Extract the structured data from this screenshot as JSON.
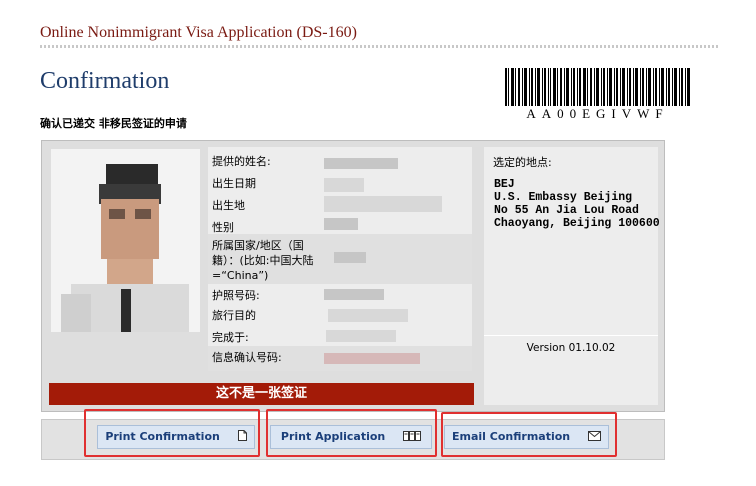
{
  "header": {
    "app_title": "Online Nonimmigrant Visa Application (DS-160)",
    "page_title": "Confirmation",
    "subtitle": "确认已递交 非移民签证的申请",
    "barcode_text": "AA00EGIVWF"
  },
  "applicant": {
    "fields": [
      {
        "label": "提供的姓名:"
      },
      {
        "label": "出生日期"
      },
      {
        "label": "出生地"
      },
      {
        "label": "性别"
      },
      {
        "label": "所属国家/地区（国籍）：(比如:中国大陆 =“China”)"
      },
      {
        "label": "护照号码:"
      },
      {
        "label": "旅行目的"
      },
      {
        "label": "完成于:"
      },
      {
        "label": "信息确认号码:"
      }
    ],
    "warning": "这不是一张签证"
  },
  "location": {
    "label": "选定的地点:",
    "lines": [
      "BEJ",
      "U.S. Embassy Beijing",
      "No 55 An Jia Lou Road",
      "Chaoyang, Beijing 100600"
    ],
    "version": "Version 01.10.02"
  },
  "buttons": {
    "print_confirmation": "Print Confirmation",
    "print_application": "Print Application",
    "email_confirmation": "Email Confirmation"
  },
  "icons": {
    "print_confirmation": "document-icon",
    "print_application": "multi-page-icon",
    "email_confirmation": "envelope-icon"
  },
  "colors": {
    "title": "#7a1a12",
    "heading": "#1f3d6b",
    "warning_bg": "#a31b08",
    "button_bg": "#dbe6f4",
    "button_text": "#1b3f7a",
    "highlight": "#e03030"
  }
}
